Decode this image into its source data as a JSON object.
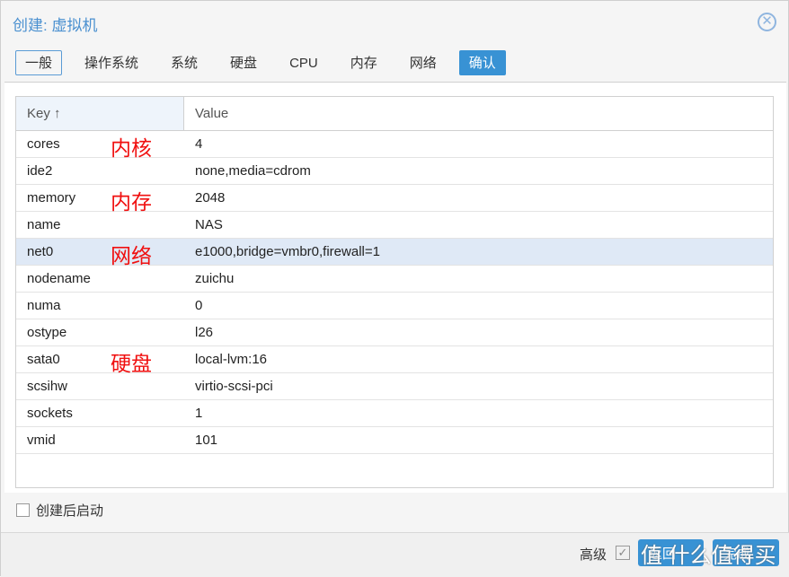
{
  "title": "创建: 虚拟机",
  "tabs": [
    "一般",
    "操作系统",
    "系统",
    "硬盘",
    "CPU",
    "内存",
    "网络",
    "确认"
  ],
  "grid": {
    "headers": {
      "key": "Key ↑",
      "value": "Value"
    },
    "rows": [
      {
        "key": "cores",
        "value": "4",
        "note": "内核"
      },
      {
        "key": "ide2",
        "value": "none,media=cdrom"
      },
      {
        "key": "memory",
        "value": "2048",
        "note": "内存"
      },
      {
        "key": "name",
        "value": "NAS"
      },
      {
        "key": "net0",
        "value": "e1000,bridge=vmbr0,firewall=1",
        "note": "网络",
        "selected": true
      },
      {
        "key": "nodename",
        "value": "zuichu"
      },
      {
        "key": "numa",
        "value": "0"
      },
      {
        "key": "ostype",
        "value": "l26"
      },
      {
        "key": "sata0",
        "value": "local-lvm:16",
        "note": "硬盘"
      },
      {
        "key": "scsihw",
        "value": "virtio-scsi-pci"
      },
      {
        "key": "sockets",
        "value": "1"
      },
      {
        "key": "vmid",
        "value": "101"
      }
    ]
  },
  "start_after_create": {
    "label": "创建后启动",
    "checked": false
  },
  "footer": {
    "advanced_label": "高级",
    "advanced_checked": true,
    "back": "返回",
    "finish": "完成"
  },
  "watermark": "值 什么值得买",
  "colors": {
    "accent": "#3892d4",
    "annotation": "#f01010",
    "selected_row": "#dfe9f6"
  }
}
